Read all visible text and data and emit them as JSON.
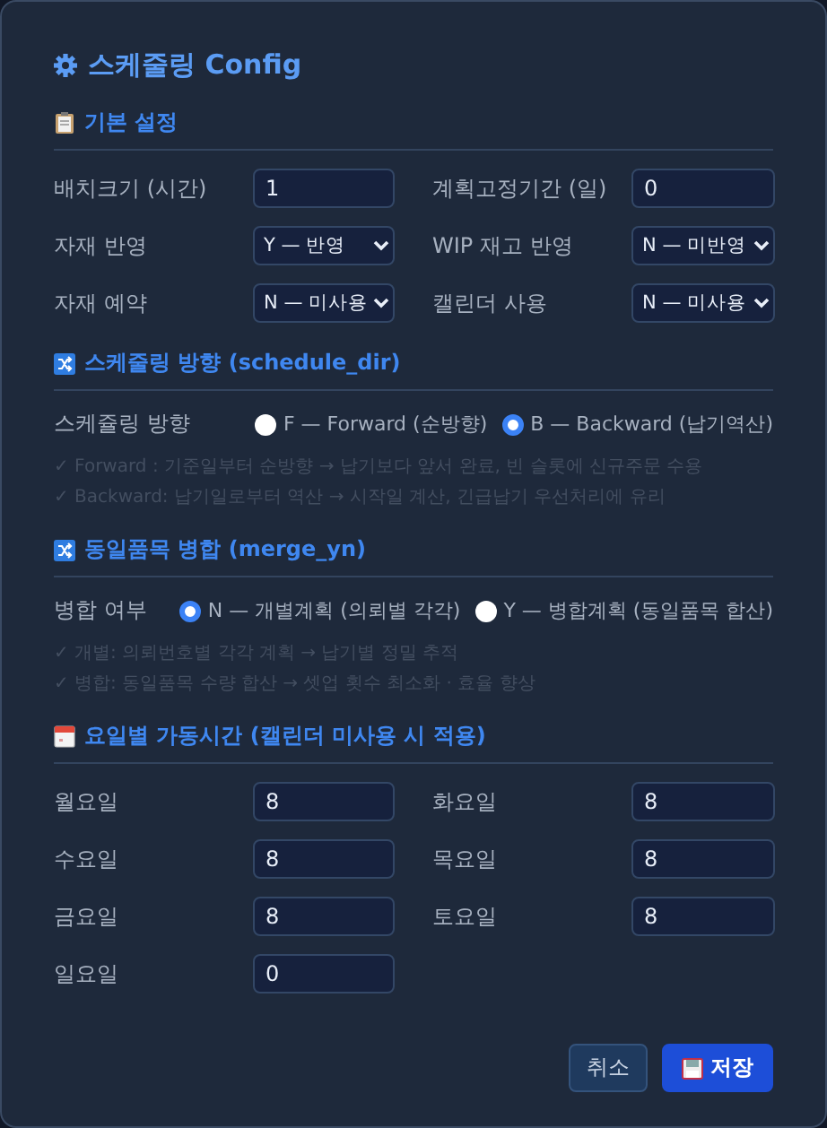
{
  "dialog": {
    "title": "스케줄링 Config"
  },
  "sections": [
    {
      "kind": "settings",
      "title": "기본 설정",
      "fields": [
        {
          "label": "배치크기 (시간)",
          "kind": "input",
          "value": "1"
        },
        {
          "label": "계획고정기간 (일)",
          "kind": "input",
          "value": "0"
        },
        {
          "label": "자재 반영",
          "kind": "select",
          "value": "Y — 반영"
        },
        {
          "label": "WIP 재고 반영",
          "kind": "select",
          "value": "N — 미반영"
        },
        {
          "label": "자재 예약",
          "kind": "select",
          "value": "N — 미사용"
        },
        {
          "label": "캘린더 사용",
          "kind": "select",
          "value": "N — 미사용"
        }
      ]
    },
    {
      "kind": "choice",
      "title": "스케줄링 방향 (schedule_dir)",
      "label": "스케쥴링 방향",
      "options": [
        {
          "label": "F — Forward (순방향)",
          "selected": false
        },
        {
          "label": "B — Backward (납기역산)",
          "selected": true
        }
      ],
      "notes": [
        "✓ Forward : 기준일부터 순방향 → 납기보다 앞서 완료, 빈 슬롯에 신규주문 수용",
        "✓ Backward: 납기일로부터 역산 → 시작일 계산, 긴급납기 우선처리에 유리"
      ]
    },
    {
      "kind": "choice",
      "title": "동일품목 병합 (merge_yn)",
      "label": "병합 여부",
      "options": [
        {
          "label": "N — 개별계획 (의뢰별 각각)",
          "selected": true
        },
        {
          "label": "Y — 병합계획 (동일품목 합산)",
          "selected": false
        }
      ],
      "notes": [
        "✓ 개별: 의뢰번호별 각각 계획 → 납기별 정밀 추적",
        "✓ 병합: 동일품목 수량 합산 → 셋업 횟수 최소화 · 효율 향상"
      ]
    },
    {
      "kind": "hours",
      "title": "요일별 가동시간 (캘린더 미사용 시 적용)",
      "fields": [
        {
          "label": "월요일",
          "kind": "input",
          "value": "8"
        },
        {
          "label": "화요일",
          "kind": "input",
          "value": "8"
        },
        {
          "label": "수요일",
          "kind": "input",
          "value": "8"
        },
        {
          "label": "목요일",
          "kind": "input",
          "value": "8"
        },
        {
          "label": "금요일",
          "kind": "input",
          "value": "8"
        },
        {
          "label": "토요일",
          "kind": "input",
          "value": "8"
        },
        {
          "label": "일요일",
          "kind": "input",
          "value": "0"
        }
      ]
    }
  ],
  "buttons": [
    {
      "label": "취소",
      "kind": "secondary"
    },
    {
      "label": "저장",
      "kind": "primary"
    }
  ]
}
